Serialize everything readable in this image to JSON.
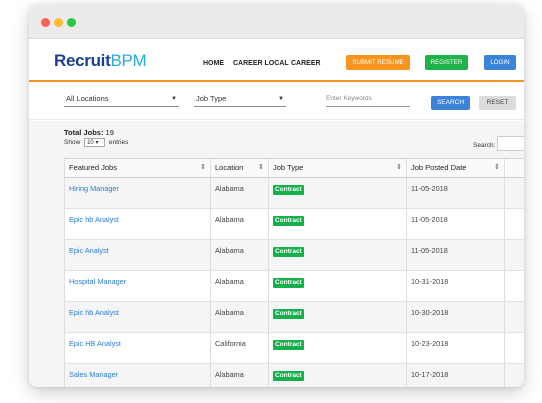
{
  "logo": {
    "part1": "Recruit",
    "part2": "BPM"
  },
  "nav": {
    "home": "HOME",
    "career_local": "CAREER LOCAL",
    "career": "CAREER"
  },
  "buttons": {
    "submit_resume": "SUBMIT RESUME",
    "register": "REGISTER",
    "login": "LOGIN"
  },
  "filters": {
    "location": "All Locations",
    "job_type": "Job Type",
    "keywords_placeholder": "Enter Keywords",
    "search": "SEARCH",
    "reset": "RESET"
  },
  "summary": {
    "total_label": "Total Jobs:",
    "total_value": "19",
    "show_label": "Show",
    "entries_value": "10",
    "entries_label": "entries",
    "search_label": "Search:"
  },
  "table": {
    "headers": [
      "Featured Jobs",
      "Location",
      "Job Type",
      "Job Posted Date"
    ],
    "rows": [
      {
        "title": "Hiring Manager",
        "location": "Alabama",
        "type": "Contract",
        "date": "11-05-2018"
      },
      {
        "title": "Epic hb Analyst",
        "location": "Alabama",
        "type": "Contract",
        "date": "11-05-2018"
      },
      {
        "title": "Epic Analyst",
        "location": "Alabama",
        "type": "Contract",
        "date": "11-05-2018"
      },
      {
        "title": "Hospital Manager",
        "location": "Alabama",
        "type": "Contract",
        "date": "10-31-2018"
      },
      {
        "title": "Epic hb Analyst",
        "location": "Alabama",
        "type": "Contract",
        "date": "10-30-2018"
      },
      {
        "title": "Epic HB Analyst",
        "location": "California",
        "type": "Contract",
        "date": "10-23-2018"
      },
      {
        "title": "Sales Manager",
        "location": "Alabama",
        "type": "Contract",
        "date": "10-17-2018"
      }
    ]
  },
  "colors": {
    "accent": "#f7941d",
    "submit": "#f7941d",
    "register": "#1fb14a",
    "login": "#3b82d9",
    "badge": "#13b04b"
  }
}
